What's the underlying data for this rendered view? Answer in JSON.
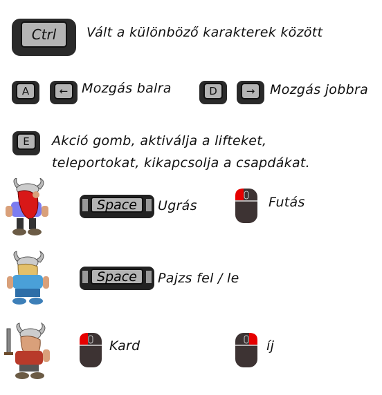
{
  "keys": {
    "ctrl": "Ctrl",
    "a": "A",
    "left_arrow": "←",
    "d": "D",
    "right_arrow": "→",
    "e": "E",
    "space": "Space"
  },
  "controls": {
    "switch": "Vált a különböző karakterek között",
    "move_left": "Mozgás balra",
    "move_right": "Mozgás jobbra",
    "action_line1": "Akció gomb, aktiválja a lifteket,",
    "action_line2": "teleportokat, kikapcsolja a csapdákat."
  },
  "characters": [
    {
      "name": "red-viking",
      "space_action": "Ugrás",
      "mouse_action": "Futás",
      "mouse_button": "left"
    },
    {
      "name": "blonde-viking",
      "space_action": "Pajzs fel / le"
    },
    {
      "name": "sword-viking",
      "left_action": "Kard",
      "right_action": "íj"
    }
  ],
  "colors": {
    "mouse_body": "#3d3333",
    "mouse_highlight": "#e60000",
    "key_face": "#b4b4b4"
  }
}
